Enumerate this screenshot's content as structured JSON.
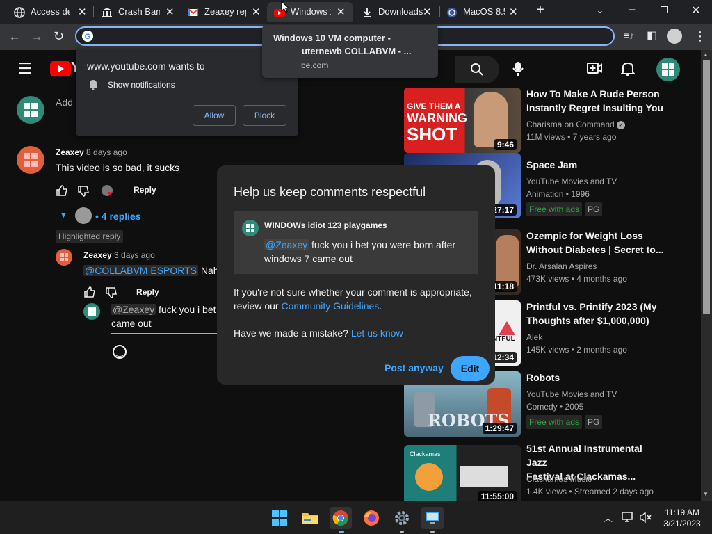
{
  "browser": {
    "tabs": [
      {
        "label": "Access deni",
        "icon": "globe-icon"
      },
      {
        "label": "Crash Band",
        "icon": "bank-icon"
      },
      {
        "label": "Zeaxey repl",
        "icon": "gmail-icon"
      },
      {
        "label": "Windows 1",
        "icon": "youtube-icon",
        "active": true
      },
      {
        "label": "Downloads",
        "icon": "download-icon"
      },
      {
        "label": "MacOS 8.5",
        "icon": "globe-icon"
      }
    ],
    "new_tab": "+",
    "omnibox_value": ""
  },
  "hover_card": {
    "title_line1": "Windows 10 VM computer -",
    "title_line2": "uternewb COLLABVM - ...",
    "domain": "be.com"
  },
  "notification": {
    "site": "www.youtube.com wants to",
    "permission": "Show notifications",
    "allow": "Allow",
    "block": "Block"
  },
  "comments": {
    "add_placeholder": "Add",
    "main": {
      "author": "Zeaxey",
      "ago": "8 days ago",
      "text": "This video is so bad, it sucks",
      "reply": "Reply",
      "replies_count": "4 replies"
    },
    "highlighted_label": "Highlighted reply",
    "reply": {
      "author": "Zeaxey",
      "ago": "3 days ago",
      "mention": "@COLLABVM ESPORTS",
      "text": "Nah",
      "reply": "Reply"
    },
    "draft": {
      "mention": "@Zeaxey",
      "text_line1": "fuck you i bet",
      "text_line2": "came out"
    }
  },
  "modal": {
    "title": "Help us keep comments respectful",
    "quote_author": "WINDOWs idiot 123 playgames",
    "quote_mention": "@Zeaxey",
    "quote_text_line1": "fuck you i bet you were born after",
    "quote_text_line2": "windows 7 came out",
    "guide_text_1": "If you're not sure whether your comment is appropriate,",
    "guide_text_2": "review our",
    "guide_link": "Community Guidelines",
    "guide_period": ".",
    "mistake_text": "Have we made a mistake?",
    "mistake_link": "Let us know",
    "post_anyway": "Post anyway",
    "edit": "Edit"
  },
  "suggestions": [
    {
      "title1": "How To Make A Rude Person",
      "title2": "Instantly Regret Insulting You",
      "channel": "Charisma on Command",
      "meta": "11M views • 7 years ago",
      "duration": "9:46",
      "thumb_text1": "GIVE THEM A",
      "thumb_text2": "WARNING",
      "thumb_text3": "SHOT"
    },
    {
      "title1": "Space Jam",
      "title2": "",
      "channel": "YouTube Movies and TV",
      "meta": "Animation • 1996",
      "duration": "27:17",
      "badge": "Free with ads",
      "pg": "PG"
    },
    {
      "title1": "Ozempic for Weight Loss",
      "title2": "Without Diabetes | Secret to...",
      "channel": "Dr. Arsalan Aspires",
      "meta": "473K views • 4 months ago",
      "duration": "11:18"
    },
    {
      "title1": "Printful vs. Printify 2023 (My",
      "title2": "Thoughts after $1,000,000)",
      "channel": "Alek",
      "meta": "145K views • 2 months ago",
      "duration": "12:34",
      "thumb_text1": "NTFUL"
    },
    {
      "title1": "Robots",
      "title2": "",
      "channel": "YouTube Movies and TV",
      "meta": "Comedy • 2005",
      "duration": "1:29:47",
      "badge": "Free with ads",
      "pg": "PG",
      "thumb_text1": "ROBOTS"
    },
    {
      "title1": "51st Annual Instrumental Jazz",
      "title2": "Festival at Clackamas...",
      "channel": "Clackamas Music",
      "meta": "1.4K views • Streamed 2 days ago",
      "duration": "11:55:00",
      "thumb_text1": "Clackamas"
    }
  ],
  "taskbar": {
    "time": "11:19 AM",
    "date": "3/21/2023"
  },
  "colors": {
    "accent_blue": "#3ea6ff",
    "chrome_focus": "#8ab4f8",
    "youtube_red": "#ff0000",
    "edit_button": "#3ea6ff"
  }
}
